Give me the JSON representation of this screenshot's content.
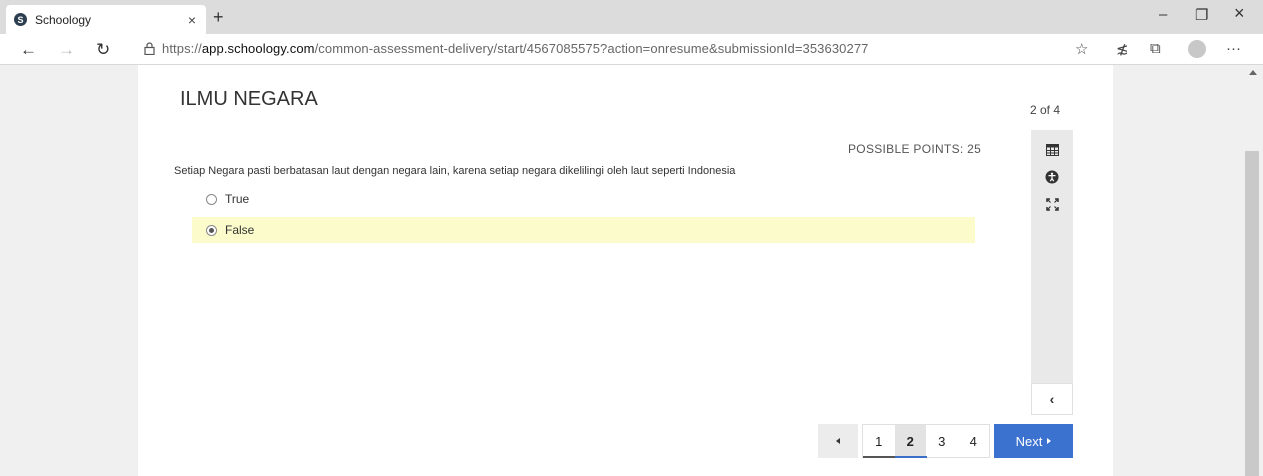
{
  "browser": {
    "tab_title": "Schoology",
    "tab_favicon": "S",
    "tab_close": "×",
    "new_tab": "+",
    "window_controls": {
      "minimize": "–",
      "maximize": "❐",
      "close": "×"
    },
    "nav": {
      "back": "←",
      "forward": "→",
      "refresh": "↻"
    },
    "url_prefix": "https://",
    "url_host": "app.schoology.com",
    "url_path": "/common-assessment-delivery/start/4567085575?action=onresume&submissionId=353630277",
    "toolbar_icons": {
      "favorite": "☆",
      "favorites_list": "≴",
      "collections": "⧉",
      "menu": "···"
    }
  },
  "assessment": {
    "title": "ILMU NEGARA",
    "counter": "2 of 4",
    "possible_points": "POSSIBLE POINTS: 25",
    "question": "Setiap Negara pasti berbatasan laut dengan negara lain, karena setiap negara dikelilingi oleh laut seperti Indonesia",
    "options": [
      {
        "label": "True",
        "selected": false
      },
      {
        "label": "False",
        "selected": true
      }
    ],
    "selected_color": "#fbfbcb",
    "tools": [
      "calendar-icon",
      "accessibility-icon",
      "fullscreen-icon"
    ],
    "collapse": "‹",
    "pagination": {
      "pages": [
        "1",
        "2",
        "3",
        "4"
      ],
      "current": "2",
      "next_label": "Next"
    },
    "accent_color": "#3c72cf"
  }
}
